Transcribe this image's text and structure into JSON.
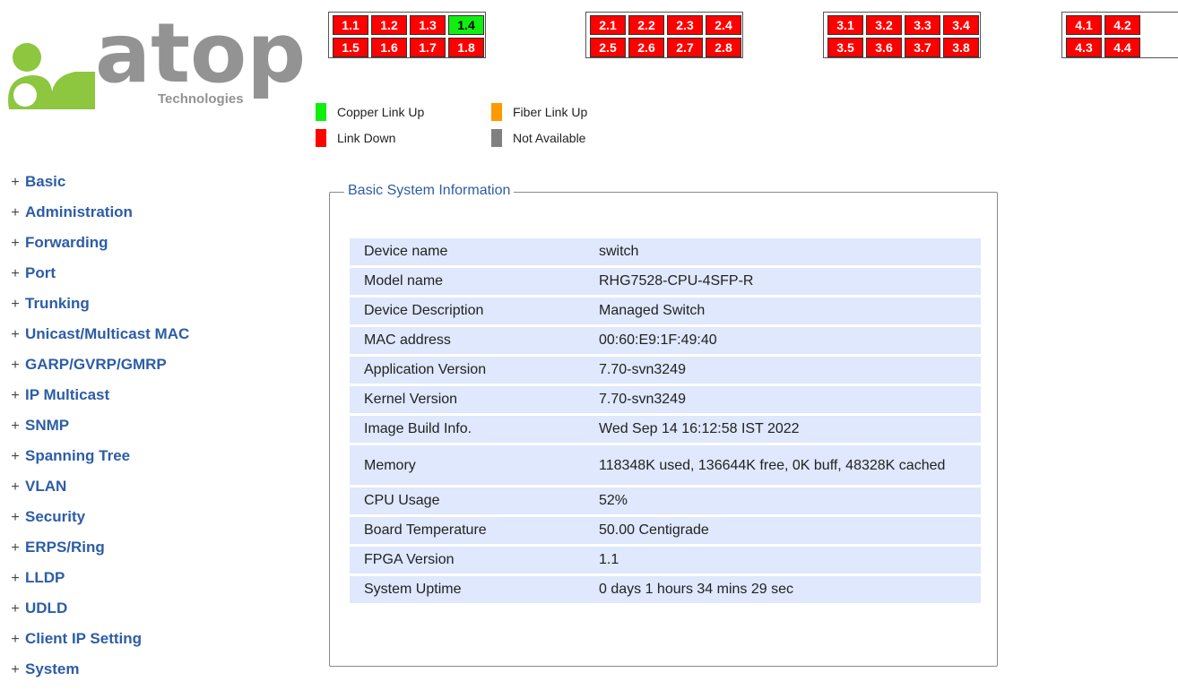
{
  "logo": {
    "brand": "atop",
    "tagline": "Technologies"
  },
  "ports": {
    "groups": [
      {
        "id": "group-1",
        "cells": [
          {
            "label": "1.1",
            "status": "down"
          },
          {
            "label": "1.2",
            "status": "down"
          },
          {
            "label": "1.3",
            "status": "down"
          },
          {
            "label": "1.4",
            "status": "copper-up"
          },
          {
            "label": "1.5",
            "status": "down"
          },
          {
            "label": "1.6",
            "status": "down"
          },
          {
            "label": "1.7",
            "status": "down"
          },
          {
            "label": "1.8",
            "status": "down"
          }
        ]
      },
      {
        "id": "group-2",
        "cells": [
          {
            "label": "2.1",
            "status": "down"
          },
          {
            "label": "2.2",
            "status": "down"
          },
          {
            "label": "2.3",
            "status": "down"
          },
          {
            "label": "2.4",
            "status": "down"
          },
          {
            "label": "2.5",
            "status": "down"
          },
          {
            "label": "2.6",
            "status": "down"
          },
          {
            "label": "2.7",
            "status": "down"
          },
          {
            "label": "2.8",
            "status": "down"
          }
        ]
      },
      {
        "id": "group-3",
        "cells": [
          {
            "label": "3.1",
            "status": "down"
          },
          {
            "label": "3.2",
            "status": "down"
          },
          {
            "label": "3.3",
            "status": "down"
          },
          {
            "label": "3.4",
            "status": "down"
          },
          {
            "label": "3.5",
            "status": "down"
          },
          {
            "label": "3.6",
            "status": "down"
          },
          {
            "label": "3.7",
            "status": "down"
          },
          {
            "label": "3.8",
            "status": "down"
          }
        ]
      },
      {
        "id": "group-4",
        "cells": [
          {
            "label": "4.1",
            "status": "down"
          },
          {
            "label": "4.2",
            "status": "down"
          },
          {
            "label": "4.3",
            "status": "down"
          },
          {
            "label": "4.4",
            "status": "down"
          }
        ]
      }
    ]
  },
  "legend": {
    "copper_up": {
      "label": "Copper Link Up",
      "color": "#11ee11"
    },
    "fiber_up": {
      "label": "Fiber Link Up",
      "color": "#ff9900"
    },
    "link_down": {
      "label": "Link Down",
      "color": "#ff0000"
    },
    "not_available": {
      "label": "Not Available",
      "color": "#808080"
    }
  },
  "sidebar": {
    "items": [
      {
        "label": "Basic"
      },
      {
        "label": "Administration"
      },
      {
        "label": "Forwarding"
      },
      {
        "label": "Port"
      },
      {
        "label": "Trunking"
      },
      {
        "label": "Unicast/Multicast MAC"
      },
      {
        "label": "GARP/GVRP/GMRP"
      },
      {
        "label": "IP Multicast"
      },
      {
        "label": "SNMP"
      },
      {
        "label": "Spanning Tree"
      },
      {
        "label": "VLAN"
      },
      {
        "label": "Security"
      },
      {
        "label": "ERPS/Ring"
      },
      {
        "label": "LLDP"
      },
      {
        "label": "UDLD"
      },
      {
        "label": "Client IP Setting"
      },
      {
        "label": "System"
      }
    ],
    "expander_glyph": "+"
  },
  "info": {
    "title": "Basic System Information",
    "rows": [
      {
        "label": "Device name",
        "value": "switch"
      },
      {
        "label": "Model name",
        "value": "RHG7528-CPU-4SFP-R"
      },
      {
        "label": "Device Description",
        "value": "Managed Switch"
      },
      {
        "label": "MAC address",
        "value": "00:60:E9:1F:49:40"
      },
      {
        "label": "Application Version",
        "value": "7.70-svn3249"
      },
      {
        "label": "Kernel Version",
        "value": "7.70-svn3249"
      },
      {
        "label": "Image Build Info.",
        "value": "Wed Sep 14 16:12:58 IST 2022"
      },
      {
        "label": "Memory",
        "value": "118348K used, 136644K free, 0K buff, 48328K cached"
      },
      {
        "label": "CPU Usage",
        "value": "52%"
      },
      {
        "label": "Board Temperature",
        "value": "50.00 Centigrade"
      },
      {
        "label": "FPGA Version",
        "value": "1.1"
      },
      {
        "label": "System Uptime",
        "value": "0 days 1 hours 34 mins 29 sec"
      }
    ]
  }
}
